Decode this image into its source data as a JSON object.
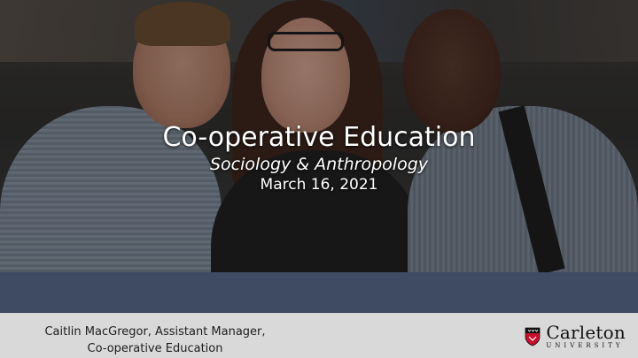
{
  "slide": {
    "title": "Co-operative Education",
    "subtitle": "Sociology & Anthropology",
    "date": "March 16, 2021"
  },
  "footer": {
    "presenter_line1": "Caitlin MacGregor, Assistant Manager,",
    "presenter_line2": "Co-operative Education"
  },
  "logo": {
    "name": "Carleton",
    "subtitle": "UNIVERSITY",
    "icon": "carleton-shield-icon"
  },
  "colors": {
    "band": "#3e4b63",
    "footer_bg": "#d9d9d9",
    "shield_red": "#c8102e"
  }
}
